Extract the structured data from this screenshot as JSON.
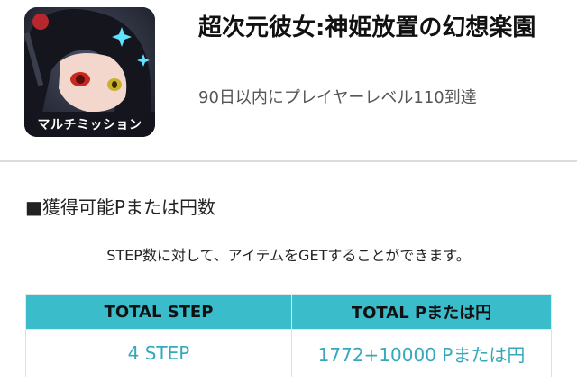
{
  "app": {
    "icon_badge": "マルチミッション",
    "title": "超次元彼女:神姫放置の幻想楽園",
    "condition": "90日以内にプレイヤーレベル110到達"
  },
  "section": {
    "heading": "■獲得可能Pまたは円数",
    "description": "STEP数に対して、アイテムをGETすることができます。"
  },
  "table": {
    "headers": [
      "TOTAL STEP",
      "TOTAL Pまたは円"
    ],
    "rows": [
      [
        "4 STEP",
        "1772+10000 Pまたは円"
      ]
    ]
  },
  "colors": {
    "accent": "#3bbccb",
    "value_text": "#35a9bb"
  }
}
